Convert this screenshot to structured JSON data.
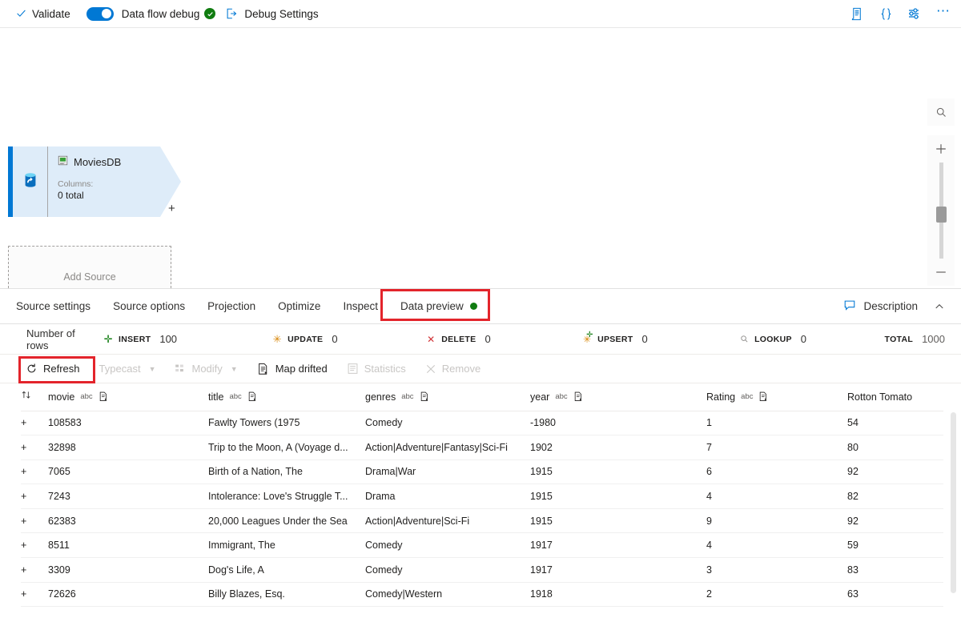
{
  "commandbar": {
    "validate": "Validate",
    "validate_icon": "checkmark-icon",
    "debug_toggle_label": "Data flow debug",
    "debug_status_icon": "green-check-icon",
    "debug_settings": "Debug Settings",
    "debug_settings_icon": "debug-settings-icon",
    "right_icons": [
      {
        "name": "script-icon",
        "glyph": "☷"
      },
      {
        "name": "code-braces-icon",
        "glyph": "{ }"
      },
      {
        "name": "settings-sliders-icon",
        "glyph": "☲"
      },
      {
        "name": "more-options-icon",
        "glyph": "⋯"
      }
    ]
  },
  "canvas": {
    "source_node": {
      "name": "MoviesDB",
      "dataset_icon": "dataset-icon",
      "source_icon": "database-source-icon",
      "columns_label": "Columns:",
      "columns_value": "0 total",
      "add_port": "+"
    },
    "add_source": "Add Source",
    "zoom_controls": [
      {
        "name": "zoom-search-icon",
        "glyph": "⌕"
      },
      {
        "name": "zoom-in-icon",
        "glyph": "+"
      },
      {
        "name": "zoom-out-icon",
        "glyph": "−"
      },
      {
        "name": "fit-to-screen-icon",
        "glyph": "⛶"
      }
    ]
  },
  "tabs": [
    {
      "label": "Source settings",
      "active": false
    },
    {
      "label": "Source options",
      "active": false
    },
    {
      "label": "Projection",
      "active": false
    },
    {
      "label": "Optimize",
      "active": false
    },
    {
      "label": "Inspect",
      "active": false
    },
    {
      "label": "Data preview",
      "active": true,
      "status_dot": "#107c10"
    }
  ],
  "panel_actions": {
    "description": "Description",
    "description_icon": "comment-icon",
    "collapse_icon": "chevron-up-icon"
  },
  "row_stats": {
    "title": "Number of rows",
    "items": [
      {
        "label": "INSERT",
        "value": "100",
        "icon": "plus-icon",
        "color": "#107c10"
      },
      {
        "label": "UPDATE",
        "value": "0",
        "icon": "asterisk-icon",
        "color": "#d8870a"
      },
      {
        "label": "DELETE",
        "value": "0",
        "icon": "cross-icon",
        "color": "#d13438"
      },
      {
        "label": "UPSERT",
        "value": "0",
        "icon": "asterisk-plus-icon",
        "color": "#d8870a"
      },
      {
        "label": "LOOKUP",
        "value": "0",
        "icon": "magnifier-icon",
        "color": "#8a8886"
      },
      {
        "label": "TOTAL",
        "value": "1000",
        "icon": "none",
        "color": "#605e5c"
      }
    ]
  },
  "toolbar": {
    "refresh": "Refresh",
    "refresh_icon": "refresh-icon",
    "typecast": "Typecast",
    "modify": "Modify",
    "map_drifted": "Map drifted",
    "map_drifted_icon": "map-drifted-icon",
    "statistics": "Statistics",
    "statistics_icon": "statistics-icon",
    "remove": "Remove",
    "remove_icon": "remove-icon"
  },
  "table": {
    "sort_icon": "sort-icon",
    "type_badge": "abc",
    "columns": [
      {
        "name": "movie",
        "type": "abc",
        "has_drift_icon": true
      },
      {
        "name": "title",
        "type": "abc",
        "has_drift_icon": true
      },
      {
        "name": "genres",
        "type": "abc",
        "has_drift_icon": true
      },
      {
        "name": "year",
        "type": "abc",
        "has_drift_icon": true
      },
      {
        "name": "Rating",
        "type": "abc",
        "has_drift_icon": true
      },
      {
        "name": "Rotton Tomato",
        "type": "",
        "has_drift_icon": false
      }
    ],
    "rows": [
      {
        "flag": "+",
        "movie": "108583",
        "title": "Fawlty Towers (1975",
        "genres": "Comedy",
        "year": "-1980",
        "rating": "1",
        "rotton_tomato": "54"
      },
      {
        "flag": "+",
        "movie": "32898",
        "title": "Trip to the Moon, A (Voyage d...",
        "genres": "Action|Adventure|Fantasy|Sci-Fi",
        "year": "1902",
        "rating": "7",
        "rotton_tomato": "80"
      },
      {
        "flag": "+",
        "movie": "7065",
        "title": "Birth of a Nation, The",
        "genres": "Drama|War",
        "year": "1915",
        "rating": "6",
        "rotton_tomato": "92"
      },
      {
        "flag": "+",
        "movie": "7243",
        "title": "Intolerance: Love's Struggle T...",
        "genres": "Drama",
        "year": "1915",
        "rating": "4",
        "rotton_tomato": "82"
      },
      {
        "flag": "+",
        "movie": "62383",
        "title": "20,000 Leagues Under the Sea",
        "genres": "Action|Adventure|Sci-Fi",
        "year": "1915",
        "rating": "9",
        "rotton_tomato": "92"
      },
      {
        "flag": "+",
        "movie": "8511",
        "title": "Immigrant, The",
        "genres": "Comedy",
        "year": "1917",
        "rating": "4",
        "rotton_tomato": "59"
      },
      {
        "flag": "+",
        "movie": "3309",
        "title": "Dog's Life, A",
        "genres": "Comedy",
        "year": "1917",
        "rating": "3",
        "rotton_tomato": "83"
      },
      {
        "flag": "+",
        "movie": "72626",
        "title": "Billy Blazes, Esq.",
        "genres": "Comedy|Western",
        "year": "1918",
        "rating": "2",
        "rotton_tomato": "63"
      }
    ]
  },
  "annotations": {
    "color": "#e3242b",
    "targets": [
      "data-preview-tab",
      "refresh-button"
    ]
  }
}
